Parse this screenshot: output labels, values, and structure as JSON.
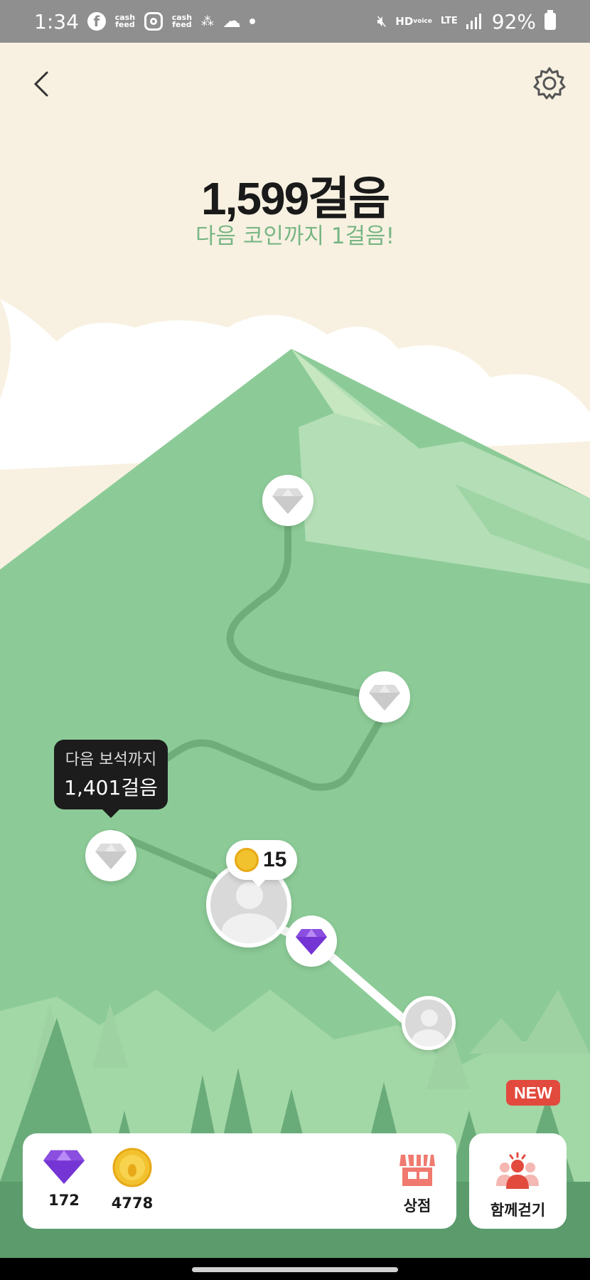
{
  "status_bar": {
    "time": "1:34",
    "cashfeed_label": "cash feed",
    "hd_label": "HD",
    "hd_sub": "voice",
    "lte_label": "LTE",
    "battery": "92%"
  },
  "header": {
    "back_icon": "chevron-left-icon",
    "settings_icon": "gear-icon"
  },
  "steps": {
    "count_label": "1,599걸음",
    "next_coin_label": "다음 코인까지 1걸음!"
  },
  "tooltip": {
    "line1": "다음 보석까지",
    "line2": "1,401걸음"
  },
  "coin_bubble": {
    "count": "15"
  },
  "bottom": {
    "gems_count": "172",
    "coins_count": "4778",
    "shop_label": "상점",
    "walk_together_label": "함께걷기",
    "new_badge": "NEW"
  },
  "colors": {
    "mountain_main": "#8ccb97",
    "mountain_light": "#b0dcb4",
    "trail": "#6fae7a",
    "gem_purple": "#9b5de5",
    "coin_gold": "#f2c12e",
    "badge_red": "#e24a3d"
  }
}
